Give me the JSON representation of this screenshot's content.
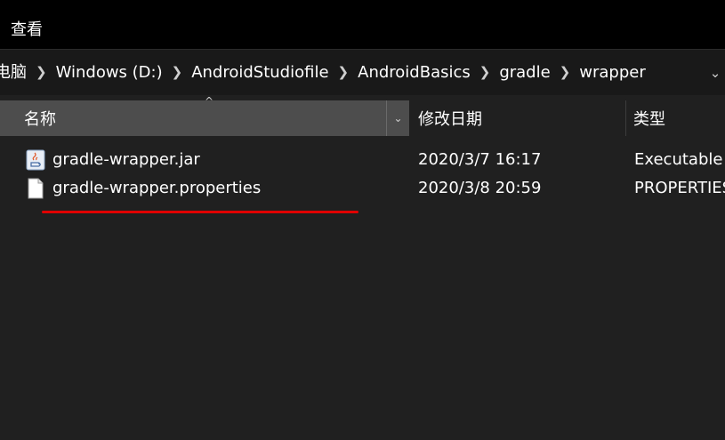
{
  "ribbon": {
    "tab_label": "查看"
  },
  "address_bar": {
    "crumbs": [
      "电脑",
      "Windows (D:)",
      "AndroidStudiofile",
      "AndroidBasics",
      "gradle",
      "wrapper"
    ],
    "separator": "❯",
    "dropdown_glyph": "⌄"
  },
  "columns": {
    "name": "名称",
    "date": "修改日期",
    "type": "类型",
    "sort_glyph": "^",
    "dropdown_glyph": "⌄"
  },
  "files": [
    {
      "name": "gradle-wrapper.jar",
      "date": "2020/3/7 16:17",
      "type": "Executable J",
      "icon": "java-jar-icon"
    },
    {
      "name": "gradle-wrapper.properties",
      "date": "2020/3/8 20:59",
      "type": "PROPERTIES",
      "icon": "file-icon"
    }
  ],
  "annotation": {
    "color": "#e00000"
  },
  "colors": {
    "ribbon_bg": "#000000",
    "content_bg": "#202020",
    "header_selected_bg": "#4d4d4d"
  }
}
